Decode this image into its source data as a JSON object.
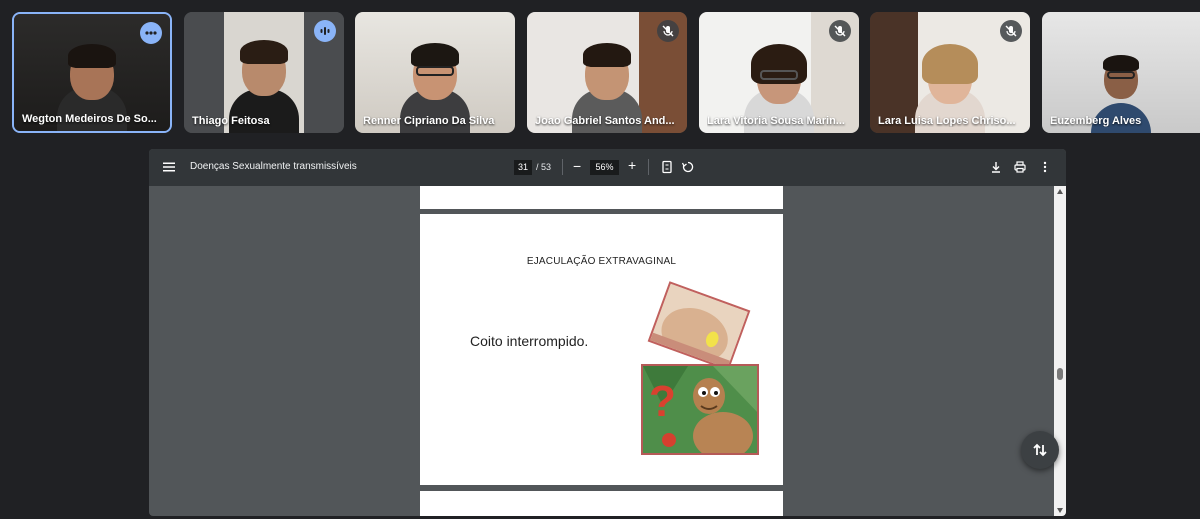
{
  "participants": [
    {
      "name": "Wegton Medeiros De So...",
      "badge": "more-options-icon",
      "active": true
    },
    {
      "name": "Thiago Feitosa",
      "badge": "speaking-icon"
    },
    {
      "name": "Renner Cipriano Da Silva",
      "badge": ""
    },
    {
      "name": "Joao Gabriel Santos And...",
      "badge": "mic-off-icon"
    },
    {
      "name": "Lara Vitoria Sousa Marin...",
      "badge": "mic-off-icon"
    },
    {
      "name": "Lara Luisa Lopes Chriso...",
      "badge": "mic-off-icon"
    },
    {
      "name": "Euzemberg Alves",
      "badge": ""
    }
  ],
  "viewer": {
    "title": "Doenças Sexualmente transmissíveis",
    "page_current": "31",
    "page_total": "/ 53",
    "zoom": "56%",
    "minus": "−",
    "plus": "+"
  },
  "slide": {
    "title": "EJACULAÇÃO EXTRAVAGINAL",
    "text": "Coito interrompido."
  },
  "colors": {
    "accent": "#8ab4f8",
    "toolbar": "#323639",
    "viewer_bg": "#525659"
  }
}
